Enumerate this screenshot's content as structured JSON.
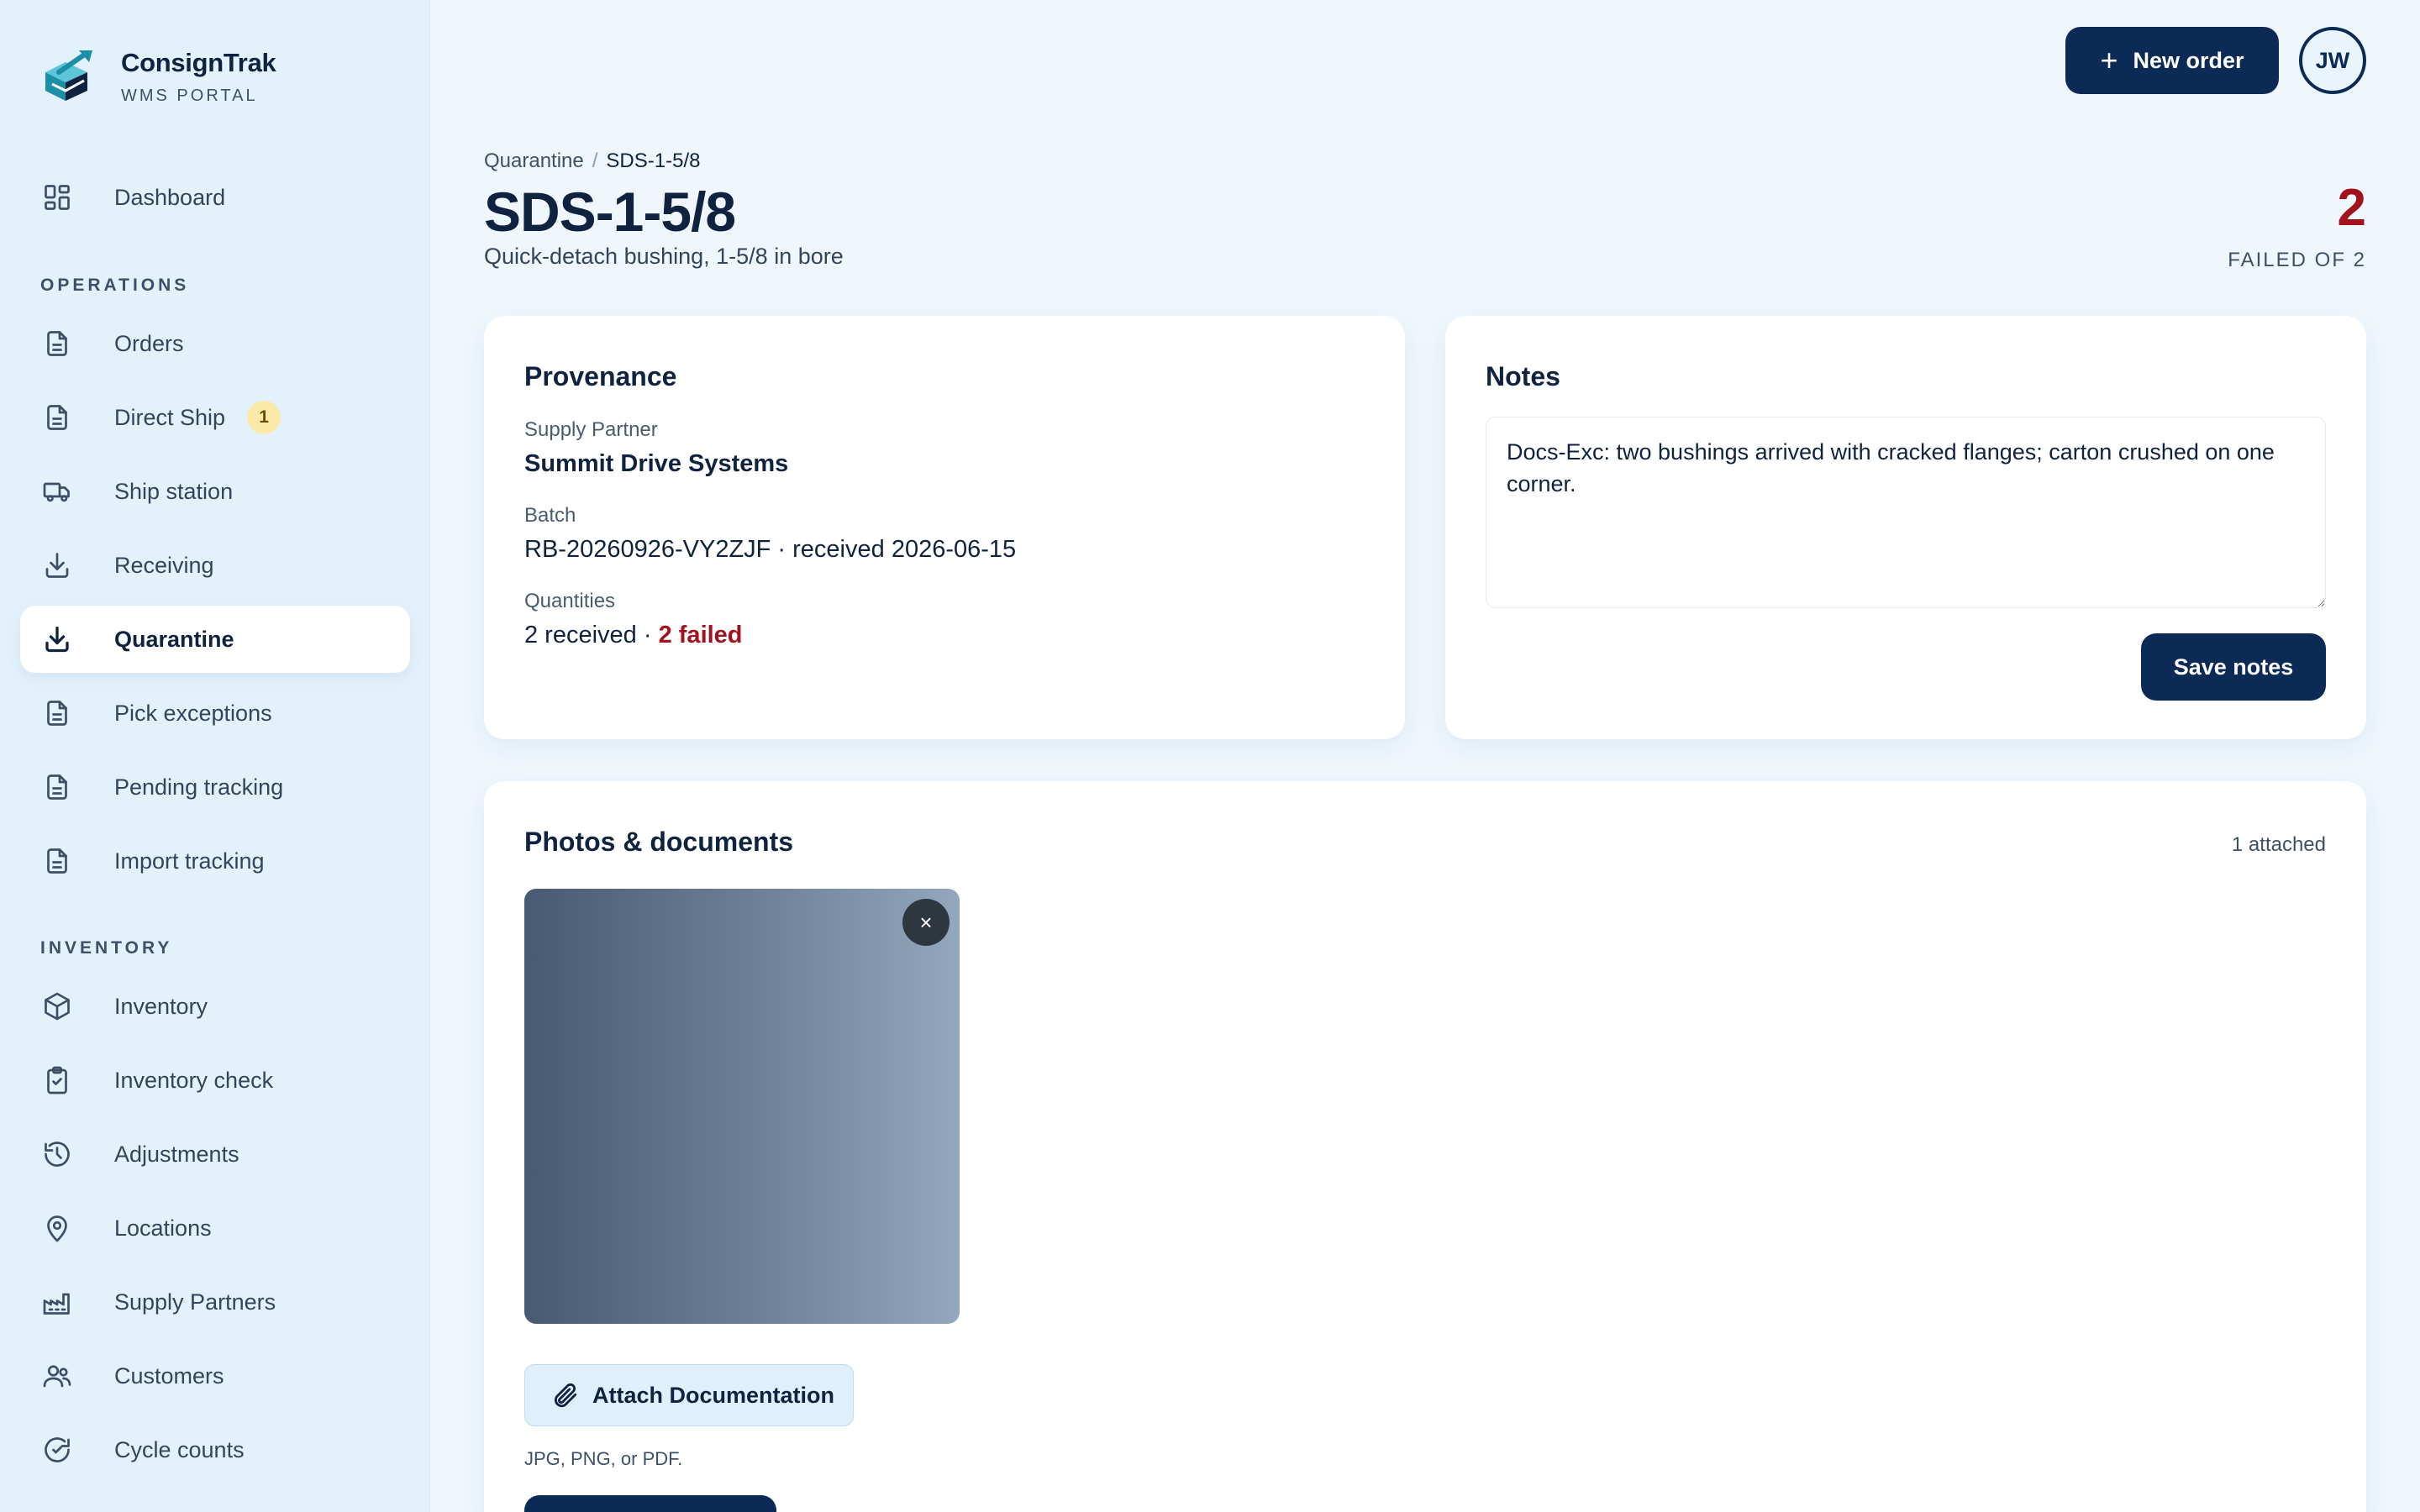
{
  "brand": {
    "name": "ConsignTrak",
    "subtitle": "WMS PORTAL",
    "logo_icon": "box-arrow-logo-icon"
  },
  "sidebar": {
    "dashboard": {
      "label": "Dashboard",
      "icon": "grid-icon"
    },
    "operations_heading": "OPERATIONS",
    "operations": [
      {
        "label": "Orders",
        "icon": "document-icon"
      },
      {
        "label": "Direct Ship",
        "icon": "document-icon",
        "badge": "1"
      },
      {
        "label": "Ship station",
        "icon": "truck-icon"
      },
      {
        "label": "Receiving",
        "icon": "download-icon"
      },
      {
        "label": "Quarantine",
        "icon": "download-icon",
        "active": true
      },
      {
        "label": "Pick exceptions",
        "icon": "document-icon"
      },
      {
        "label": "Pending tracking",
        "icon": "document-icon"
      },
      {
        "label": "Import tracking",
        "icon": "document-icon"
      }
    ],
    "inventory_heading": "INVENTORY",
    "inventory": [
      {
        "label": "Inventory",
        "icon": "cube-icon"
      },
      {
        "label": "Inventory check",
        "icon": "clipboard-check-icon"
      },
      {
        "label": "Adjustments",
        "icon": "history-icon"
      },
      {
        "label": "Locations",
        "icon": "map-pin-icon"
      },
      {
        "label": "Supply Partners",
        "icon": "factory-icon"
      },
      {
        "label": "Customers",
        "icon": "users-icon"
      },
      {
        "label": "Cycle counts",
        "icon": "refresh-check-icon"
      }
    ]
  },
  "topbar": {
    "new_order_label": "New order",
    "avatar_initials": "JW"
  },
  "header": {
    "breadcrumb_parent": "Quarantine",
    "breadcrumb_separator": "/",
    "breadcrumb_current": "SDS-1-5/8",
    "title": "SDS-1-5/8",
    "subtitle": "Quick-detach bushing, 1-5/8 in bore",
    "failed_count": "2",
    "failed_label": "FAILED OF 2"
  },
  "provenance": {
    "title": "Provenance",
    "supply_partner_label": "Supply Partner",
    "supply_partner_value": "Summit Drive Systems",
    "batch_label": "Batch",
    "batch_value": "RB-20260926-VY2ZJF · received 2026-06-15",
    "quantities_label": "Quantities",
    "quantities_received": "2 received",
    "quantities_separator": " · ",
    "quantities_failed": "2 failed"
  },
  "notes": {
    "title": "Notes",
    "value": "Docs-Exc: two bushings arrived with cracked flanges; carton crushed on one corner.",
    "save_label": "Save notes"
  },
  "documents": {
    "title": "Photos & documents",
    "count_label": "1 attached",
    "remove_label": "×",
    "attach_label": "Attach Documentation",
    "hint": "JPG, PNG, or PDF."
  },
  "colors": {
    "primary": "#0b2a55",
    "danger": "#a1121c",
    "sidebar_bg": "#e3f1fb",
    "page_bg": "#eff6fc"
  }
}
